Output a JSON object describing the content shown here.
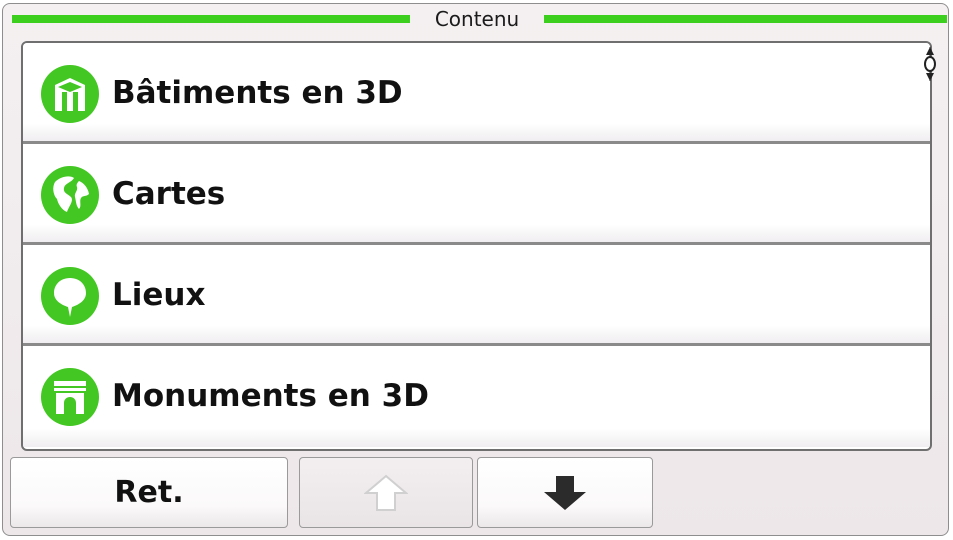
{
  "header": {
    "title": "Contenu"
  },
  "list": {
    "items": [
      {
        "label": "Bâtiments en 3D",
        "icon": "building-3d-icon"
      },
      {
        "label": "Cartes",
        "icon": "globe-icon"
      },
      {
        "label": "Lieux",
        "icon": "map-pin-icon"
      },
      {
        "label": "Monuments en 3D",
        "icon": "monument-icon"
      }
    ]
  },
  "footer": {
    "back_label": "Ret.",
    "up_icon": "arrow-up-icon",
    "down_icon": "arrow-down-icon"
  },
  "colors": {
    "accent": "#3ccf1e",
    "icon_green": "#43c722",
    "text": "#111111",
    "disabled": "#d4d4d4"
  }
}
